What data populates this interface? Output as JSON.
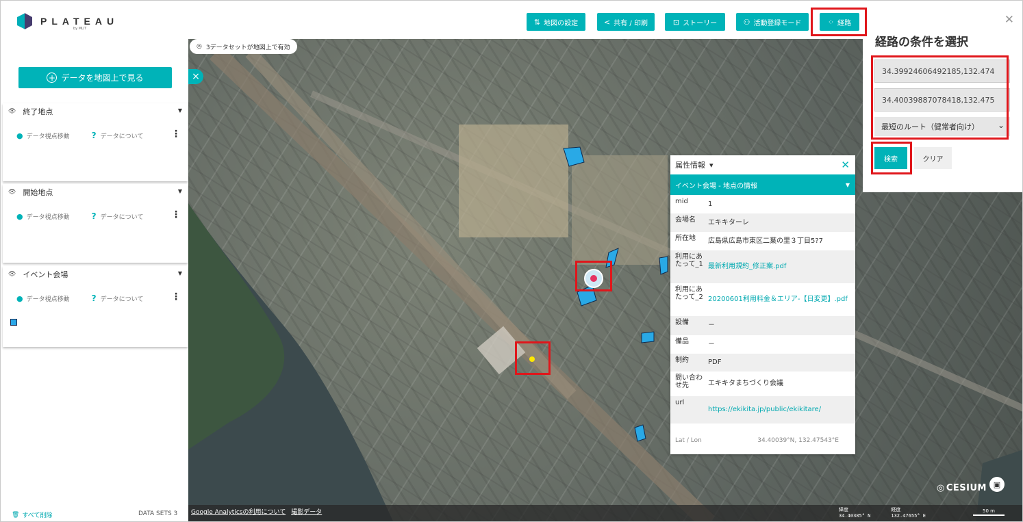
{
  "header": {
    "logo_text": "PLATEAU",
    "logo_sub": "by MLIT",
    "buttons": {
      "map_settings": "地図の設定",
      "share_print": "共有 / 印刷",
      "story": "ストーリー",
      "activity_mode": "活動登録モード",
      "route": "経路"
    }
  },
  "sidebar": {
    "add_data_label": "データを地図上で見る",
    "layers": [
      {
        "name": "終了地点",
        "move_label": "データ視点移動",
        "about_label": "データについて"
      },
      {
        "name": "開始地点",
        "move_label": "データ視点移動",
        "about_label": "データについて"
      },
      {
        "name": "イベント会場",
        "move_label": "データ視点移動",
        "about_label": "データについて"
      }
    ],
    "delete_all": "すべて削除",
    "datasets_count": "DATA SETS 3"
  },
  "map": {
    "active_datasets": "3データセットが地図上で有効",
    "footer_links": [
      "Google Analyticsの利用について",
      "撮影データ"
    ],
    "lat_label": "緯度",
    "lat_value": "34.40385° N",
    "lon_label": "経度",
    "lon_value": "132.47655° E",
    "scale": "50 m",
    "cesium": "CESIUM"
  },
  "attributes": {
    "title": "属性情報",
    "feature_title": "イベント会場 - 地点の情報",
    "rows": [
      {
        "key": "mid",
        "value": "1"
      },
      {
        "key": "会場名",
        "value": "エキキターレ"
      },
      {
        "key": "所在地",
        "value": "広島県広島市東区二葉の里３丁目5?7"
      },
      {
        "key": "利用にあたって_1",
        "value": "最新利用規約_修正案.pdf"
      },
      {
        "key": "利用にあたって_2",
        "value": "20200601利用料金＆エリア-【日変更】.pdf"
      },
      {
        "key": "設備",
        "value": "－"
      },
      {
        "key": "備品",
        "value": "－"
      },
      {
        "key": "制約",
        "value": "PDF"
      },
      {
        "key": "問い合わせ先",
        "value": "エキキタまちづくり会議"
      },
      {
        "key": "url",
        "value": "https://ekikita.jp/public/ekikitare/"
      }
    ],
    "latlon_label": "Lat / Lon",
    "latlon_value": "34.40039°N, 132.47543°E"
  },
  "route_panel": {
    "title": "経路の条件を選択",
    "start_value": "34.39924606492185,132.474",
    "end_value": "34.40039887078418,132.475",
    "mode_selected": "最短のルート（健常者向け）",
    "search_label": "検索",
    "clear_label": "クリア"
  },
  "colors": {
    "accent": "#00b3b8",
    "highlight": "#e0161b"
  }
}
